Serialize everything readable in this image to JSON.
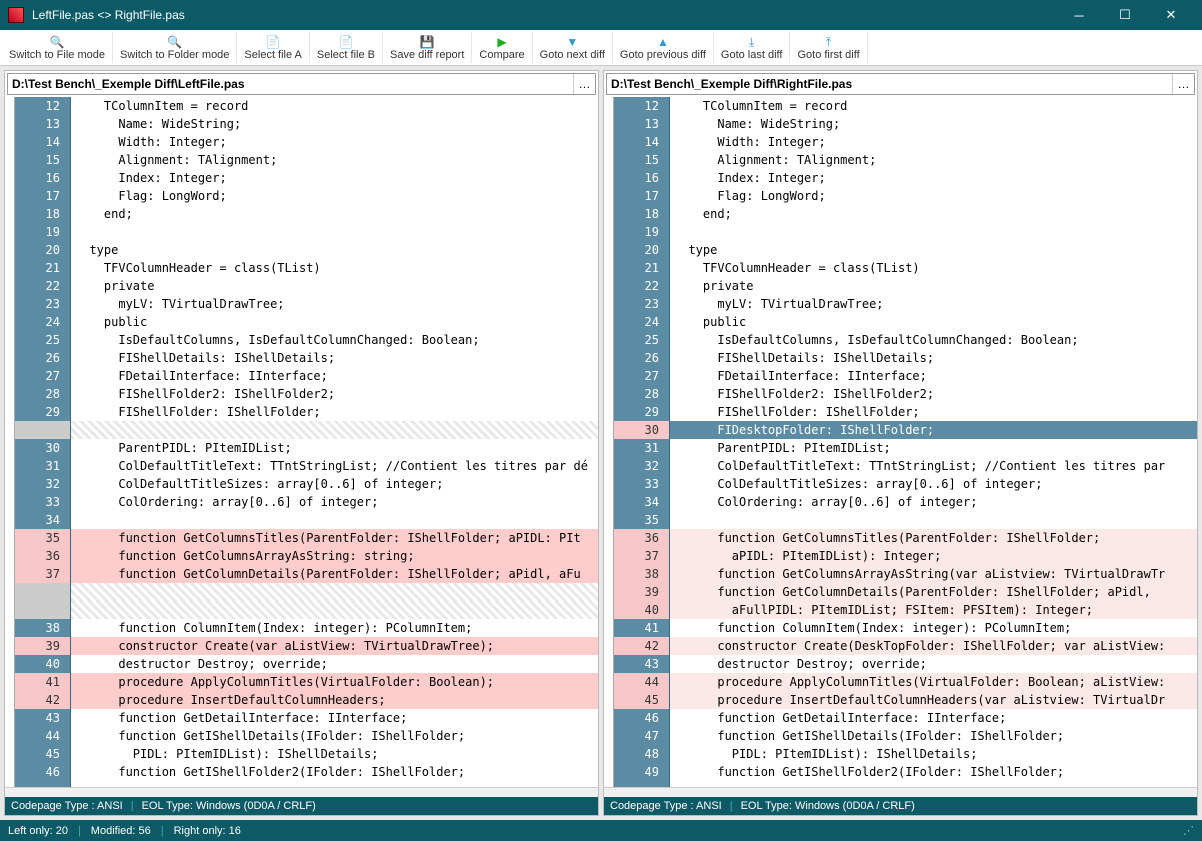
{
  "window": {
    "title": "LeftFile.pas <> RightFile.pas"
  },
  "toolbar": {
    "switch_file": "Switch to File mode",
    "switch_folder": "Switch to Folder mode",
    "select_a": "Select file A",
    "select_b": "Select file B",
    "save_report": "Save diff report",
    "compare": "Compare",
    "next_diff": "Goto next diff",
    "prev_diff": "Goto previous diff",
    "last_diff": "Goto last diff",
    "first_diff": "Goto first diff"
  },
  "left": {
    "path": "D:\\Test Bench\\_Exemple Diff\\LeftFile.pas",
    "status": {
      "codepage": "Codepage Type : ANSI",
      "eol": "EOL Type: Windows (0D0A / CRLF)"
    },
    "lines": [
      {
        "ln": "12",
        "text": "    TColumnItem = record",
        "style": "none"
      },
      {
        "ln": "13",
        "text": "      Name: WideString;",
        "style": "none"
      },
      {
        "ln": "14",
        "text": "      Width: Integer;",
        "style": "none"
      },
      {
        "ln": "15",
        "text": "      Alignment: TAlignment;",
        "style": "none"
      },
      {
        "ln": "16",
        "text": "      Index: Integer;",
        "style": "none"
      },
      {
        "ln": "17",
        "text": "      Flag: LongWord;",
        "style": "none"
      },
      {
        "ln": "18",
        "text": "    end;",
        "style": "none"
      },
      {
        "ln": "19",
        "text": "",
        "style": "none"
      },
      {
        "ln": "20",
        "text": "  type",
        "style": "none"
      },
      {
        "ln": "21",
        "text": "    TFVColumnHeader = class(TList)",
        "style": "none"
      },
      {
        "ln": "22",
        "text": "    private",
        "style": "none"
      },
      {
        "ln": "23",
        "text": "      myLV: TVirtualDrawTree;",
        "style": "none"
      },
      {
        "ln": "24",
        "text": "    public",
        "style": "none"
      },
      {
        "ln": "25",
        "text": "      IsDefaultColumns, IsDefaultColumnChanged: Boolean;",
        "style": "none"
      },
      {
        "ln": "26",
        "text": "      FIShellDetails: IShellDetails;",
        "style": "none"
      },
      {
        "ln": "27",
        "text": "      FDetailInterface: IInterface;",
        "style": "none"
      },
      {
        "ln": "28",
        "text": "      FIShellFolder2: IShellFolder2;",
        "style": "none"
      },
      {
        "ln": "29",
        "text": "      FIShellFolder: IShellFolder;",
        "style": "none"
      },
      {
        "ln": "",
        "text": "",
        "style": "missing"
      },
      {
        "ln": "30",
        "text": "      ParentPIDL: PItemIDList;",
        "style": "none"
      },
      {
        "ln": "31",
        "text": "      ColDefaultTitleText: TTntStringList; //Contient les titres par dé",
        "style": "none"
      },
      {
        "ln": "32",
        "text": "      ColDefaultTitleSizes: array[0..6] of integer;",
        "style": "none"
      },
      {
        "ln": "33",
        "text": "      ColOrdering: array[0..6] of integer;",
        "style": "none"
      },
      {
        "ln": "34",
        "text": "",
        "style": "none"
      },
      {
        "ln": "35",
        "text": "      function GetColumnsTitles(ParentFolder: IShellFolder; aPIDL: PIt",
        "style": "del"
      },
      {
        "ln": "36",
        "text": "      function GetColumnsArrayAsString: string;",
        "style": "del"
      },
      {
        "ln": "37",
        "text": "      function GetColumnDetails(ParentFolder: IShellFolder; aPidl, aFu",
        "style": "del"
      },
      {
        "ln": "",
        "text": "",
        "style": "missing"
      },
      {
        "ln": "",
        "text": "",
        "style": "missing"
      },
      {
        "ln": "38",
        "text": "      function ColumnItem(Index: integer): PColumnItem;",
        "style": "none"
      },
      {
        "ln": "39",
        "text": "      constructor Create(var aListView: TVirtualDrawTree);",
        "style": "del"
      },
      {
        "ln": "40",
        "text": "      destructor Destroy; override;",
        "style": "none"
      },
      {
        "ln": "41",
        "text": "      procedure ApplyColumnTitles(VirtualFolder: Boolean);",
        "style": "del"
      },
      {
        "ln": "42",
        "text": "      procedure InsertDefaultColumnHeaders;",
        "style": "del"
      },
      {
        "ln": "43",
        "text": "      function GetDetailInterface: IInterface;",
        "style": "none"
      },
      {
        "ln": "44",
        "text": "      function GetIShellDetails(IFolder: IShellFolder;",
        "style": "none"
      },
      {
        "ln": "45",
        "text": "        PIDL: PItemIDList): IShellDetails;",
        "style": "none"
      },
      {
        "ln": "46",
        "text": "      function GetIShellFolder2(IFolder: IShellFolder;",
        "style": "none"
      }
    ]
  },
  "right": {
    "path": "D:\\Test Bench\\_Exemple Diff\\RightFile.pas",
    "status": {
      "codepage": "Codepage Type : ANSI",
      "eol": "EOL Type: Windows (0D0A / CRLF)"
    },
    "lines": [
      {
        "ln": "12",
        "text": "    TColumnItem = record",
        "style": "none"
      },
      {
        "ln": "13",
        "text": "      Name: WideString;",
        "style": "none"
      },
      {
        "ln": "14",
        "text": "      Width: Integer;",
        "style": "none"
      },
      {
        "ln": "15",
        "text": "      Alignment: TAlignment;",
        "style": "none"
      },
      {
        "ln": "16",
        "text": "      Index: Integer;",
        "style": "none"
      },
      {
        "ln": "17",
        "text": "      Flag: LongWord;",
        "style": "none"
      },
      {
        "ln": "18",
        "text": "    end;",
        "style": "none"
      },
      {
        "ln": "19",
        "text": "",
        "style": "none"
      },
      {
        "ln": "20",
        "text": "  type",
        "style": "none"
      },
      {
        "ln": "21",
        "text": "    TFVColumnHeader = class(TList)",
        "style": "none"
      },
      {
        "ln": "22",
        "text": "    private",
        "style": "none"
      },
      {
        "ln": "23",
        "text": "      myLV: TVirtualDrawTree;",
        "style": "none"
      },
      {
        "ln": "24",
        "text": "    public",
        "style": "none"
      },
      {
        "ln": "25",
        "text": "      IsDefaultColumns, IsDefaultColumnChanged: Boolean;",
        "style": "none"
      },
      {
        "ln": "26",
        "text": "      FIShellDetails: IShellDetails;",
        "style": "none"
      },
      {
        "ln": "27",
        "text": "      FDetailInterface: IInterface;",
        "style": "none"
      },
      {
        "ln": "28",
        "text": "      FIShellFolder2: IShellFolder2;",
        "style": "none"
      },
      {
        "ln": "29",
        "text": "      FIShellFolder: IShellFolder;",
        "style": "none"
      },
      {
        "ln": "30",
        "text": "      FIDesktopFolder: IShellFolder;",
        "style": "add"
      },
      {
        "ln": "31",
        "text": "      ParentPIDL: PItemIDList;",
        "style": "none"
      },
      {
        "ln": "32",
        "text": "      ColDefaultTitleText: TTntStringList; //Contient les titres par",
        "style": "none"
      },
      {
        "ln": "33",
        "text": "      ColDefaultTitleSizes: array[0..6] of integer;",
        "style": "none"
      },
      {
        "ln": "34",
        "text": "      ColOrdering: array[0..6] of integer;",
        "style": "none"
      },
      {
        "ln": "35",
        "text": "",
        "style": "none"
      },
      {
        "ln": "36",
        "text": "      function GetColumnsTitles(ParentFolder: IShellFolder;",
        "style": "mod"
      },
      {
        "ln": "37",
        "text": "        aPIDL: PItemIDList): Integer;",
        "style": "mod"
      },
      {
        "ln": "38",
        "text": "      function GetColumnsArrayAsString(var aListview: TVirtualDrawTr",
        "style": "mod"
      },
      {
        "ln": "39",
        "text": "      function GetColumnDetails(ParentFolder: IShellFolder; aPidl,",
        "style": "mod"
      },
      {
        "ln": "40",
        "text": "        aFullPIDL: PItemIDList; FSItem: PFSItem): Integer;",
        "style": "mod"
      },
      {
        "ln": "41",
        "text": "      function ColumnItem(Index: integer): PColumnItem;",
        "style": "none"
      },
      {
        "ln": "42",
        "text": "      constructor Create(DeskTopFolder: IShellFolder; var aListView:",
        "style": "mod"
      },
      {
        "ln": "43",
        "text": "      destructor Destroy; override;",
        "style": "none"
      },
      {
        "ln": "44",
        "text": "      procedure ApplyColumnTitles(VirtualFolder: Boolean; aListView:",
        "style": "mod"
      },
      {
        "ln": "45",
        "text": "      procedure InsertDefaultColumnHeaders(var aListview: TVirtualDr",
        "style": "mod"
      },
      {
        "ln": "46",
        "text": "      function GetDetailInterface: IInterface;",
        "style": "none"
      },
      {
        "ln": "47",
        "text": "      function GetIShellDetails(IFolder: IShellFolder;",
        "style": "none"
      },
      {
        "ln": "48",
        "text": "        PIDL: PItemIDList): IShellDetails;",
        "style": "none"
      },
      {
        "ln": "49",
        "text": "      function GetIShellFolder2(IFolder: IShellFolder;",
        "style": "none"
      }
    ]
  },
  "bottom_status": {
    "left_only": "Left only: 20",
    "modified": "Modified: 56",
    "right_only": "Right only: 16"
  }
}
